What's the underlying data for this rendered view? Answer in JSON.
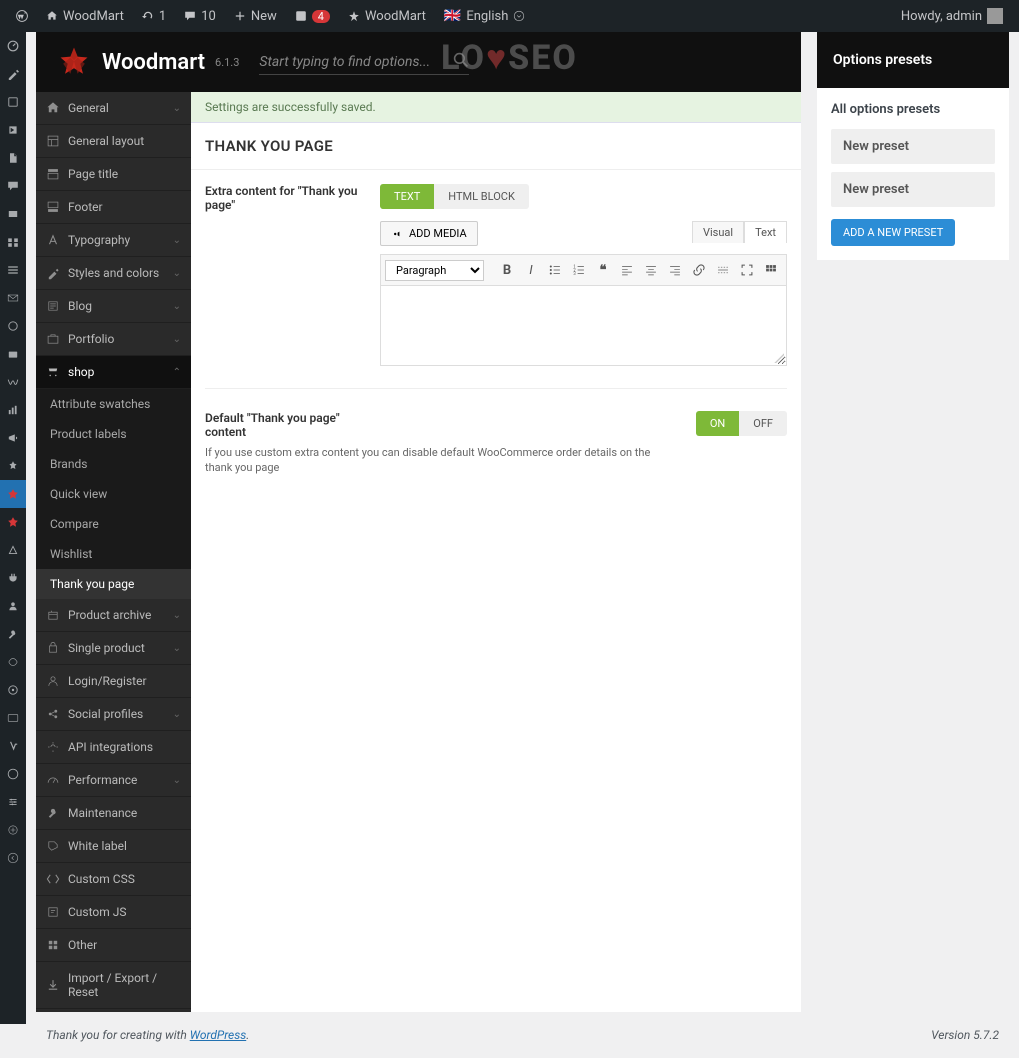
{
  "admin_bar": {
    "site_name": "WoodMart",
    "updates_count": "1",
    "comments_count": "10",
    "new_label": "New",
    "yoast_count": "4",
    "theme_label": "WoodMart",
    "language": "English",
    "howdy": "Howdy, admin"
  },
  "theme_header": {
    "title": "Woodmart",
    "version": "6.1.3",
    "search_placeholder": "Start typing to find options..."
  },
  "watermark_a": "LO",
  "watermark_b": "SEO",
  "nav": {
    "general": "General",
    "general_layout": "General layout",
    "page_title": "Page title",
    "footer": "Footer",
    "typography": "Typography",
    "styles_colors": "Styles and colors",
    "blog": "Blog",
    "portfolio": "Portfolio",
    "shop": "shop",
    "shop_sub": {
      "attribute_swatches": "Attribute swatches",
      "product_labels": "Product labels",
      "brands": "Brands",
      "quick_view": "Quick view",
      "compare": "Compare",
      "wishlist": "Wishlist",
      "thank_you_page": "Thank you page"
    },
    "product_archive": "Product archive",
    "single_product": "Single product",
    "login_register": "Login/Register",
    "social_profiles": "Social profiles",
    "api_integrations": "API integrations",
    "performance": "Performance",
    "maintenance": "Maintenance",
    "white_label": "White label",
    "custom_css": "Custom CSS",
    "custom_js": "Custom JS",
    "other": "Other",
    "import_export": "Import / Export / Reset"
  },
  "content": {
    "notice": "Settings are successfully saved.",
    "heading": "THANK YOU PAGE",
    "extra_content_label": "Extra content for \"Thank you page\"",
    "tab_text": "TEXT",
    "tab_html_block": "HTML BLOCK",
    "add_media": "ADD MEDIA",
    "editor_tab_visual": "Visual",
    "editor_tab_text": "Text",
    "format_select": "Paragraph",
    "default_label": "Default \"Thank you page\" content",
    "default_desc": "If you use custom extra content you can disable default WooCommerce order details on the thank you page",
    "toggle_on": "ON",
    "toggle_off": "OFF"
  },
  "presets": {
    "heading": "Options presets",
    "subheading": "All options presets",
    "items": [
      "New preset",
      "New preset"
    ],
    "add_button": "ADD A NEW PRESET"
  },
  "footer": {
    "thank_you": "Thank you for creating with ",
    "wordpress": "WordPress",
    "period": ".",
    "version": "Version 5.7.2"
  }
}
